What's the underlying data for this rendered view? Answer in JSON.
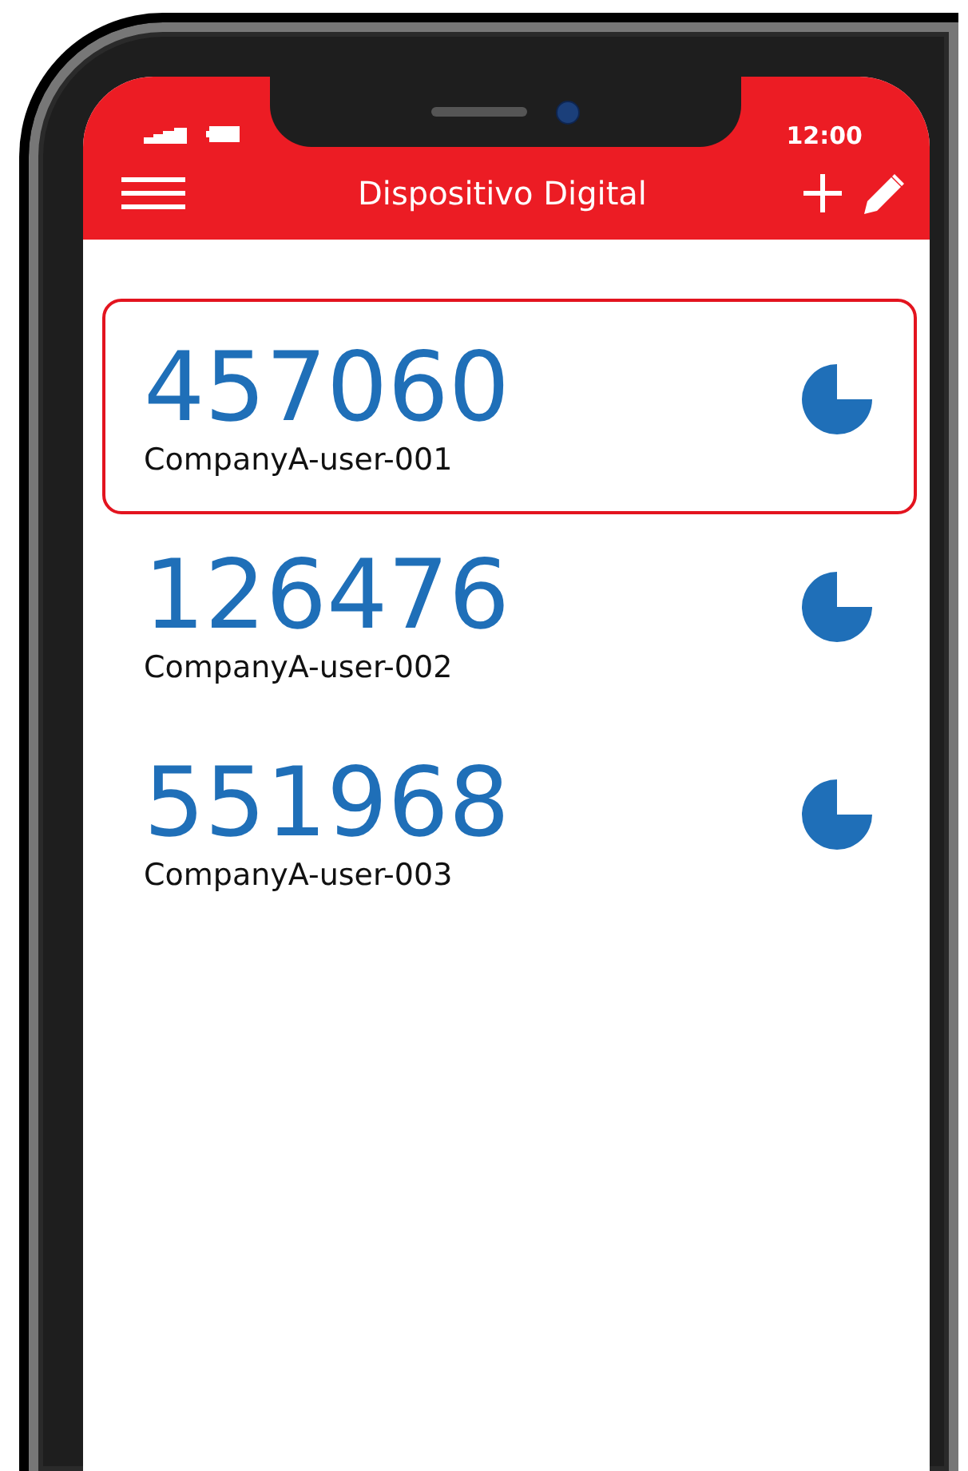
{
  "status_bar": {
    "time": "12:00"
  },
  "header": {
    "title": "Dispositivo Digital"
  },
  "tokens": [
    {
      "code": "457060",
      "account": "CompanyA-user-001",
      "selected": true
    },
    {
      "code": "126476",
      "account": "CompanyA-user-002",
      "selected": false
    },
    {
      "code": "551968",
      "account": "CompanyA-user-003",
      "selected": false
    }
  ]
}
